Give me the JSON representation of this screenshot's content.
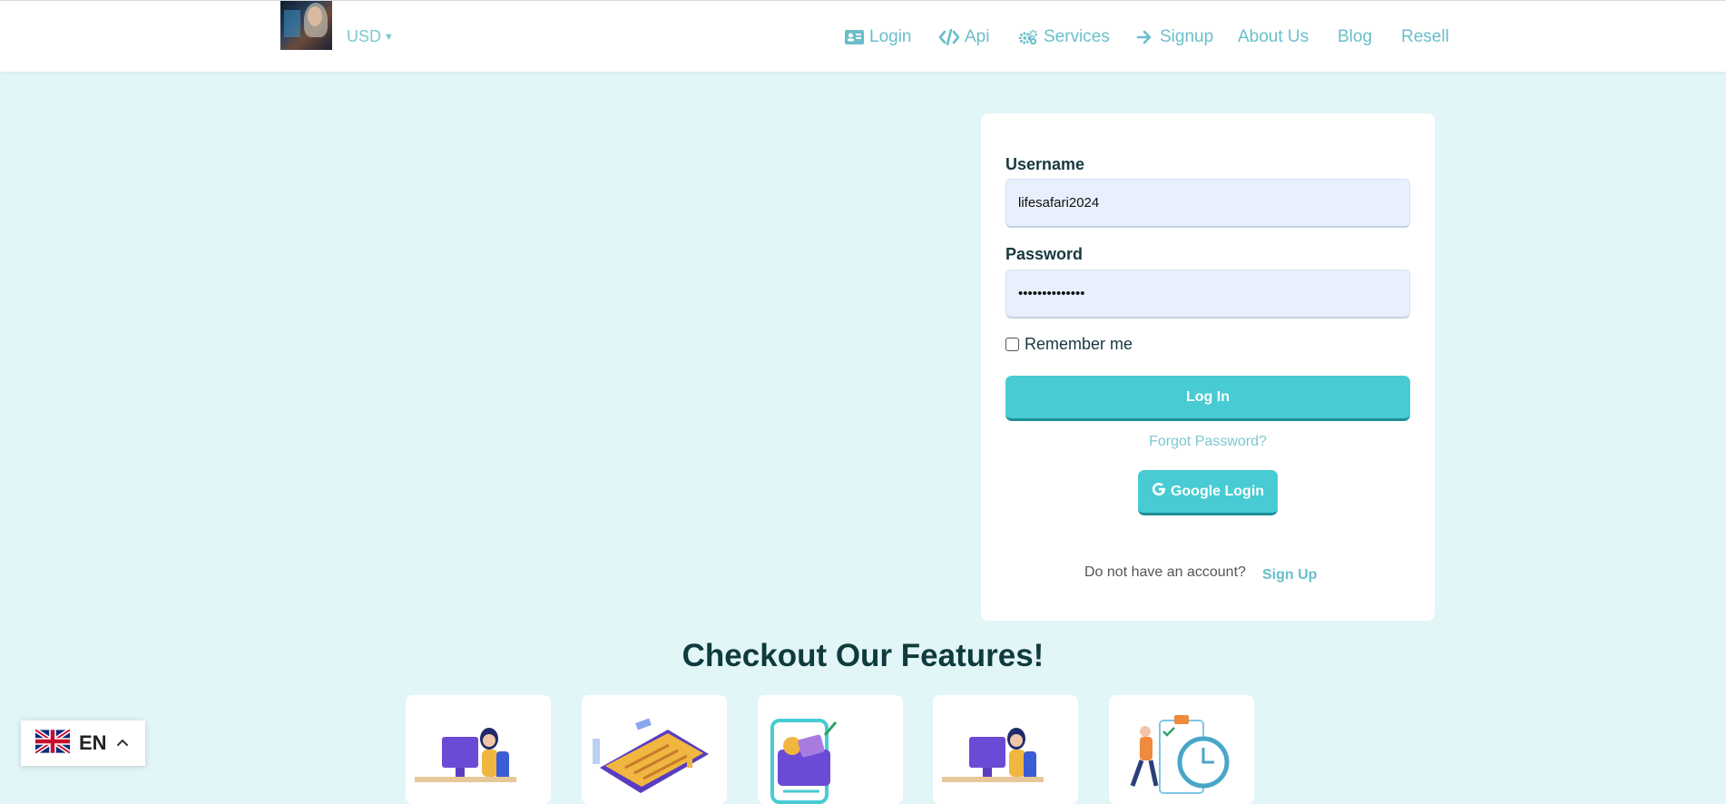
{
  "header": {
    "currency": "USD",
    "nav": [
      {
        "label": "Login",
        "icon": "id-card-icon"
      },
      {
        "label": "Api",
        "icon": "code-icon"
      },
      {
        "label": "Services",
        "icon": "gears-icon"
      },
      {
        "label": "Signup",
        "icon": "arrow-right-icon"
      },
      {
        "label": "About Us",
        "icon": ""
      },
      {
        "label": "Blog",
        "icon": ""
      },
      {
        "label": "Resell",
        "icon": ""
      }
    ]
  },
  "login": {
    "username_label": "Username",
    "username_value": "lifesafari2024",
    "password_label": "Password",
    "password_value": "••••••••••••••",
    "remember_label": "Remember me",
    "remember_checked": false,
    "login_button": "Log In",
    "forgot_link": "Forgot Password?",
    "google_button": "Google Login",
    "no_account_text": "Do not have an account?",
    "signup_link": "Sign Up"
  },
  "features": {
    "title": "Checkout Our Features!",
    "cards": [
      {
        "illustration": "person-at-computer-illustration"
      },
      {
        "illustration": "phone-checklist-illustration"
      },
      {
        "illustration": "mobile-wallet-illustration"
      },
      {
        "illustration": "person-at-computer-illustration"
      },
      {
        "illustration": "clock-schedule-illustration"
      }
    ]
  },
  "language": {
    "code": "EN",
    "flag": "uk-flag-icon"
  },
  "colors": {
    "accent": "#48cbd2",
    "link": "#69bfca",
    "page_bg": "#e2f6f8",
    "heading": "#0f3a3e"
  }
}
